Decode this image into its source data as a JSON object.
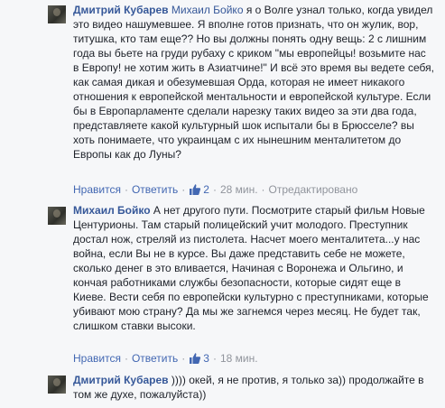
{
  "comments": [
    {
      "author": "Дмитрий Кубарев",
      "mention": "Михаил Бойко",
      "text": "я о Волге узнал только, когда увидел это видео нашумевшее. Я вполне готов признать, что он жулик, вор, титушка, кто там еще?? Но вы должны понять одну вещь: 2 с лишним года вы бьете на груди рубаху с криком \"мы европейцы! возьмите нас в Европу! не хотим жить в Азиатчине!\" И всё это время вы ведете себя, как самая дикая и обезумевшая Орда, которая не имеет никакого отношения к европейской ментальности и европейской культуре. Если бы в Европарламенте сделали нарезку таких видео за эти два года, представляете какой культурный шок испытали бы в Брюсселе? вы хоть понимаете, что украинцам с их нынешним менталитетом до Европы как до Луны?",
      "like_label": "Нравится",
      "reply_label": "Ответить",
      "likes": "2",
      "time": "28 мин.",
      "edited": "Отредактировано"
    },
    {
      "author": "Михаил Бойко",
      "text": "А нет другого пути. Посмотрите старый фильм Новые Центурионы. Там старый полицейский учит молодого. Преступник достал нож, стреляй из пистолета. Насчет моего менталитета...у нас война, если Вы не в курсе. Вы даже представить себе не можете, сколько денег в это вливается, Начиная с Воронежа и Ольгино, и кончая работниками службы безопасности, которые сидят еще в Киеве. Вести себя по европейски культурно с преступниками, которые убивают мою страну? Да мы же загнемся через месяц. Не будет так, слишком ставки высоки.",
      "like_label": "Нравится",
      "reply_label": "Ответить",
      "likes": "3",
      "time": "18 мин."
    },
    {
      "author": "Дмитрий Кубарев",
      "text": ")))) окей, я не против, я только за)) продолжайте в том же духе, пожалуйста))"
    }
  ],
  "icons": {
    "like": "thumbs-up-icon"
  },
  "colors": {
    "link": "#365899",
    "meta": "#90949c",
    "like_blue": "#4267b2"
  }
}
